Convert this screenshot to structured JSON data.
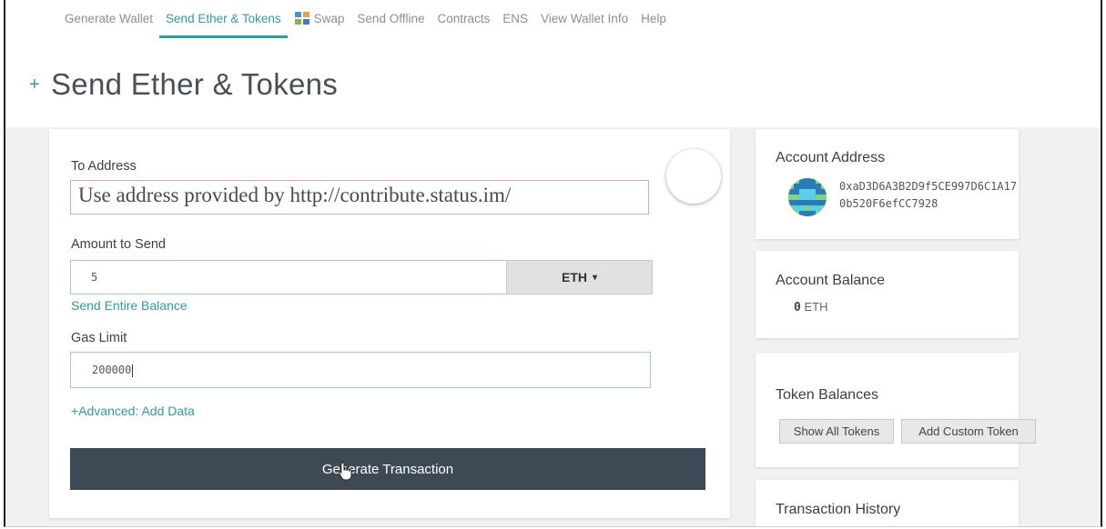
{
  "nav": {
    "items": [
      {
        "label": "Generate Wallet"
      },
      {
        "label": "Send Ether & Tokens"
      },
      {
        "label": "Swap"
      },
      {
        "label": "Send Offline"
      },
      {
        "label": "Contracts"
      },
      {
        "label": "ENS"
      },
      {
        "label": "View Wallet Info"
      },
      {
        "label": "Help"
      }
    ],
    "active": "Send Ether & Tokens"
  },
  "page": {
    "plus": "+",
    "title": "Send Ether & Tokens"
  },
  "form": {
    "to_address_label": "To Address",
    "to_address_value": "Use address provided by http://contribute.status.im/",
    "amount_label": "Amount to Send",
    "amount_value": "5",
    "currency": "ETH",
    "caret": "▾",
    "send_entire_balance": "Send Entire Balance",
    "gas_limit_label": "Gas Limit",
    "gas_limit_value": "200000",
    "advanced_link": "+Advanced: Add Data",
    "generate_button": "Generate Transaction"
  },
  "sidebar": {
    "account_address_title": "Account Address",
    "address_line1": "0xaD3D6A3B2D9f5CE997D6C1A17",
    "address_line2": "0b520F6efCC7928",
    "account_balance_title": "Account Balance",
    "balance_amount": "0",
    "balance_unit": "ETH",
    "token_balances_title": "Token Balances",
    "show_all_tokens": "Show All Tokens",
    "add_custom_token": "Add Custom Token",
    "transaction_history_title": "Transaction History"
  },
  "colors": {
    "accent": "#2f9c9f",
    "button_dark": "#3d4a56"
  }
}
